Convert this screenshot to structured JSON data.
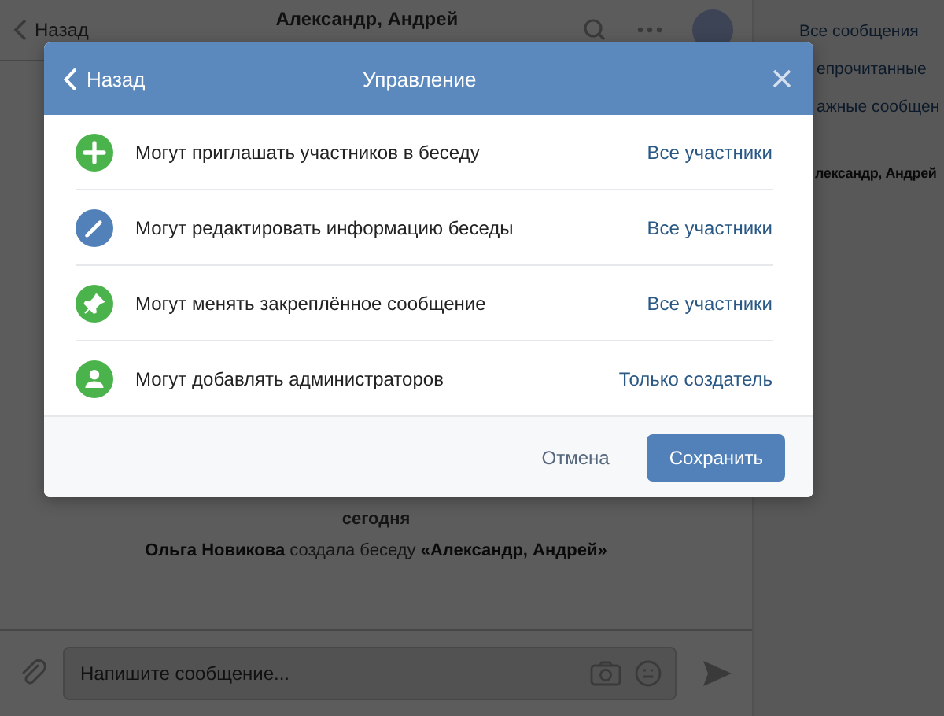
{
  "chat_header": {
    "back": "Назад",
    "title": "Александр, Андрей"
  },
  "sidebar": {
    "items": [
      {
        "label": "Все сообщения",
        "kind": "link"
      },
      {
        "label": "епрочитанные",
        "kind": "link"
      },
      {
        "label": "ажные сообщен",
        "kind": "link"
      },
      {
        "label": "лександр, Андрей",
        "kind": "chat"
      }
    ]
  },
  "messages": [
    {
      "text": "сегодня",
      "kind": "date"
    },
    {
      "text": "**Ольга Новикова** создала беседу **«Александр, Андрей»**",
      "kind": "service"
    }
  ],
  "composer": {
    "placeholder": "Напишите сообщение..."
  },
  "dialog": {
    "back": "Назад",
    "title": "Управление",
    "rows": [
      {
        "kind": "plus",
        "color": "#4bb34b",
        "label": "Могут приглашать участников в беседу",
        "value": "Все участники"
      },
      {
        "kind": "pencil",
        "color": "#5181b8",
        "label": "Могут редактировать информацию беседы",
        "value": "Все участники"
      },
      {
        "kind": "pin",
        "color": "#4bb34b",
        "label": "Могут менять закреплённое сообщение",
        "value": "Все участники"
      },
      {
        "kind": "person",
        "color": "#4bb34b",
        "label": "Могут добавлять администраторов",
        "value": "Только создатель"
      }
    ],
    "cancel": "Отмена",
    "save": "Сохранить"
  }
}
